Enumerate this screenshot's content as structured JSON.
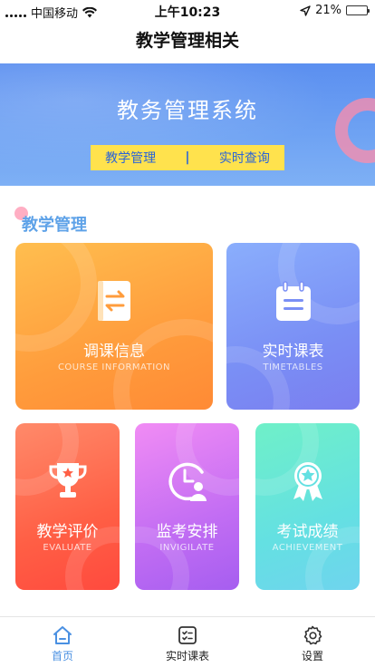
{
  "status_bar": {
    "carrier": "中国移动",
    "time": "上午10:23",
    "battery_percent": "21%",
    "battery_level": 0.21
  },
  "nav": {
    "title": "教学管理相关"
  },
  "banner": {
    "title": "教务管理系统",
    "link_left": "教学管理",
    "divider": "|",
    "link_right": "实时查询"
  },
  "section": {
    "title": "教学管理"
  },
  "cards": [
    {
      "cn": "调课信息",
      "en": "COURSE INFORMATION",
      "icon": "exchange-book-icon"
    },
    {
      "cn": "实时课表",
      "en": "TIMETABLES",
      "icon": "calendar-icon"
    },
    {
      "cn": "教学评价",
      "en": "EVALUATE",
      "icon": "trophy-icon"
    },
    {
      "cn": "监考安排",
      "en": "INVIGILATE",
      "icon": "clock-person-icon"
    },
    {
      "cn": "考试成绩",
      "en": "ACHIEVEMENT",
      "icon": "medal-icon"
    }
  ],
  "tabbar": {
    "items": [
      {
        "label": "首页",
        "icon": "home-icon",
        "active": true
      },
      {
        "label": "实时课表",
        "icon": "schedule-icon",
        "active": false
      },
      {
        "label": "设置",
        "icon": "gear-icon",
        "active": false
      }
    ],
    "active_color": "#4a90e2"
  },
  "colors": {
    "banner": "#6fa3f3",
    "accent_yellow": "#ffe24d",
    "section_title": "#5ea2e8"
  }
}
